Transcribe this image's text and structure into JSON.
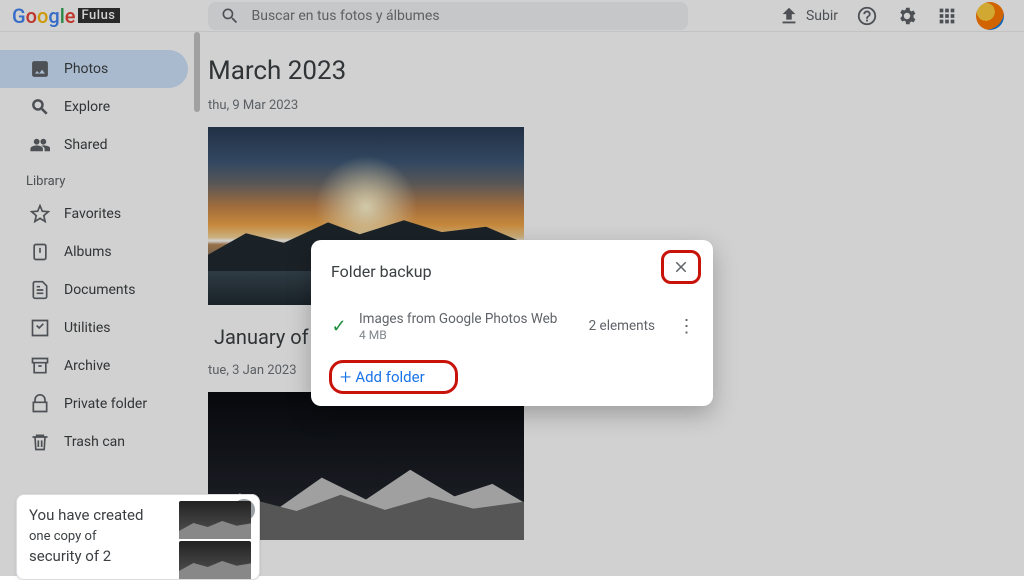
{
  "header": {
    "logo_parts": {
      "g1": "G",
      "g2": "o",
      "g3": "o",
      "g4": "g",
      "g5": "l",
      "g6": "e"
    },
    "logo_badge": "Fulus",
    "search_placeholder": "Buscar en tus fotos y álbumes",
    "upload_label": "Subir"
  },
  "sidebar": {
    "nav": [
      {
        "label": "Photos",
        "icon": "image"
      },
      {
        "label": "Explore",
        "icon": "search"
      },
      {
        "label": "Shared",
        "icon": "people"
      }
    ],
    "section_label": "Library",
    "library": [
      {
        "label": "Favorites",
        "icon": "star"
      },
      {
        "label": "Albums",
        "icon": "album"
      },
      {
        "label": "Documents",
        "icon": "document"
      },
      {
        "label": "Utilities",
        "icon": "utilities"
      },
      {
        "label": "Archive",
        "icon": "archive"
      },
      {
        "label": "Private folder",
        "icon": "lock"
      },
      {
        "label": "Trash can",
        "icon": "trash"
      }
    ]
  },
  "main": {
    "groups": [
      {
        "title": "March 2023",
        "date": "thu, 9 Mar 2023"
      },
      {
        "title": "January of",
        "date": "tue, 3 Jan 2023"
      }
    ]
  },
  "toast": {
    "line_a": "You have created",
    "line_b": "one copy of",
    "line_c": "security of 2"
  },
  "dialog": {
    "title": "Folder backup",
    "folder_name": "Images from Google Photos Web",
    "folder_size": "4 MB",
    "elements_label": "2 elements",
    "add_label": "Add folder"
  }
}
